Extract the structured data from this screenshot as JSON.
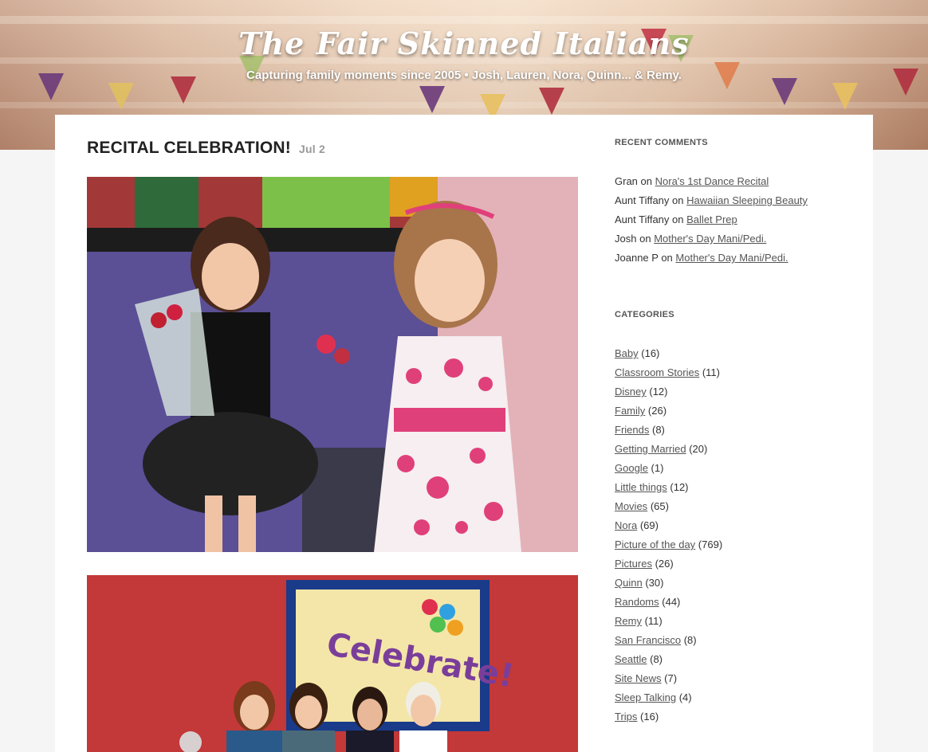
{
  "site": {
    "title": "The Fair Skinned Italians",
    "tagline": "Capturing family moments since 2005 • Josh, Lauren, Nora, Quinn... & Remy."
  },
  "post": {
    "title": "RECITAL CELEBRATION!",
    "date": "Jul 2",
    "photo2_sign_text": "Celebrate!"
  },
  "sidebar": {
    "recent_comments": {
      "title": "RECENT COMMENTS",
      "items": [
        {
          "author": "Gran",
          "on": "on",
          "post": "Nora's 1st Dance Recital"
        },
        {
          "author": "Aunt Tiffany",
          "on": "on",
          "post": "Hawaiian Sleeping Beauty"
        },
        {
          "author": "Aunt Tiffany",
          "on": "on",
          "post": "Ballet Prep"
        },
        {
          "author": "Josh",
          "on": "on",
          "post": "Mother's Day Mani/Pedi."
        },
        {
          "author": "Joanne P",
          "on": "on",
          "post": "Mother's Day Mani/Pedi."
        }
      ]
    },
    "categories": {
      "title": "CATEGORIES",
      "items": [
        {
          "name": "Baby",
          "count": "(16)"
        },
        {
          "name": "Classroom Stories",
          "count": "(11)"
        },
        {
          "name": "Disney",
          "count": "(12)"
        },
        {
          "name": "Family",
          "count": "(26)"
        },
        {
          "name": "Friends",
          "count": "(8)"
        },
        {
          "name": "Getting Married",
          "count": "(20)"
        },
        {
          "name": "Google",
          "count": "(1)"
        },
        {
          "name": "Little things",
          "count": "(12)"
        },
        {
          "name": "Movies",
          "count": "(65)"
        },
        {
          "name": "Nora",
          "count": "(69)"
        },
        {
          "name": "Picture of the day",
          "count": "(769)"
        },
        {
          "name": "Pictures",
          "count": "(26)"
        },
        {
          "name": "Quinn",
          "count": "(30)"
        },
        {
          "name": "Randoms",
          "count": "(44)"
        },
        {
          "name": "Remy",
          "count": "(11)"
        },
        {
          "name": "San Francisco",
          "count": "(8)"
        },
        {
          "name": "Seattle",
          "count": "(8)"
        },
        {
          "name": "Site News",
          "count": "(7)"
        },
        {
          "name": "Sleep Talking",
          "count": "(4)"
        },
        {
          "name": "Trips",
          "count": "(16)"
        }
      ]
    }
  },
  "colors": {
    "accent_link": "#555555",
    "page_bg": "#f5f5f5"
  }
}
